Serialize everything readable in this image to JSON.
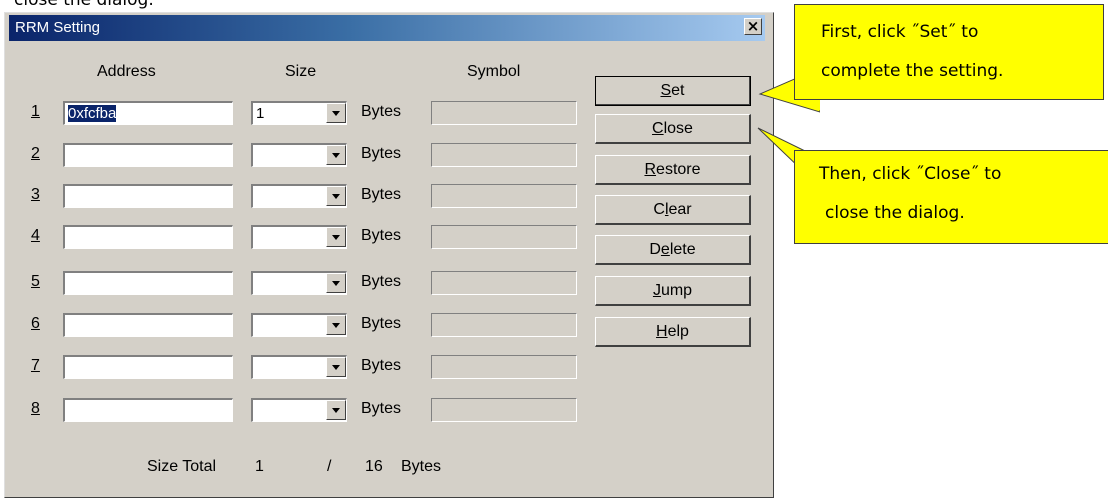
{
  "page": {
    "top_text": "close the dialog."
  },
  "dialog": {
    "title": "RRM Setting",
    "close_glyph": "×",
    "columns": {
      "address": "Address",
      "size": "Size",
      "symbol": "Symbol"
    },
    "rows": [
      {
        "num": "1",
        "address": "0xfcfba",
        "size": "1",
        "bytes": "Bytes"
      },
      {
        "num": "2",
        "address": "",
        "size": "",
        "bytes": "Bytes"
      },
      {
        "num": "3",
        "address": "",
        "size": "",
        "bytes": "Bytes"
      },
      {
        "num": "4",
        "address": "",
        "size": "",
        "bytes": "Bytes"
      },
      {
        "num": "5",
        "address": "",
        "size": "",
        "bytes": "Bytes"
      },
      {
        "num": "6",
        "address": "",
        "size": "",
        "bytes": "Bytes"
      },
      {
        "num": "7",
        "address": "",
        "size": "",
        "bytes": "Bytes"
      },
      {
        "num": "8",
        "address": "",
        "size": "",
        "bytes": "Bytes"
      }
    ],
    "buttons": {
      "set": {
        "mnemonic": "S",
        "rest": "et"
      },
      "close": {
        "mnemonic": "C",
        "rest": "lose"
      },
      "restore": {
        "mnemonic": "R",
        "rest": "estore"
      },
      "clear": {
        "pre": "C",
        "mnemonic": "l",
        "rest": "ear"
      },
      "delete": {
        "pre": "D",
        "mnemonic": "e",
        "rest": "lete"
      },
      "jump": {
        "mnemonic": "J",
        "rest": "ump"
      },
      "help": {
        "mnemonic": "H",
        "rest": "elp"
      }
    },
    "size_total": {
      "label": "Size Total",
      "current": "1",
      "separator": "/",
      "max": "16",
      "unit": "Bytes"
    }
  },
  "callouts": {
    "first": {
      "line1": "First, click ˝Set˝ to",
      "line2": "complete the setting."
    },
    "then": {
      "line1": "Then, click ˝Close˝ to",
      "line2": "close the dialog."
    }
  },
  "colors": {
    "dialog_bg": "#d4d0c8",
    "titlebar_start": "#0a246a",
    "titlebar_end": "#a6caf0",
    "callout_bg": "#ffff00",
    "selection_bg": "#0a246a"
  }
}
